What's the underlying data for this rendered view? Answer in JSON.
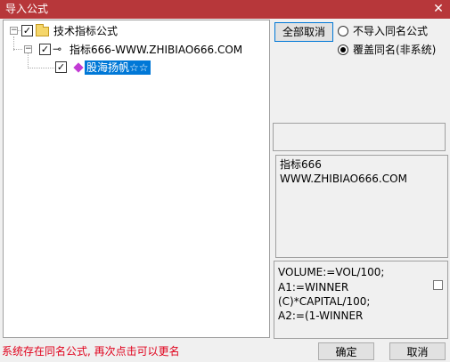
{
  "window": {
    "title": "导入公式",
    "close_glyph": "✕"
  },
  "tree": {
    "root": {
      "label": "技术指标公式",
      "checked": true,
      "expanded": true,
      "expander": "−"
    },
    "group": {
      "label": "指标666-WWW.ZHIBIAO666.COM",
      "checked": true,
      "expanded": true,
      "expander": "−"
    },
    "formula": {
      "label": "股海扬帆☆☆",
      "checked": true,
      "selected": true
    }
  },
  "actions": {
    "deselect_all_label": "全部取消",
    "ok_label": "确定",
    "cancel_label": "取消"
  },
  "options": {
    "skip_same_name_label": "不导入同名公式",
    "overwrite_label": "覆盖同名(非系统)",
    "selected": "overwrite"
  },
  "description": {
    "lines": [
      "指标666",
      "WWW.ZHIBIAO666.COM"
    ]
  },
  "code_preview": {
    "lines": [
      "VOLUME:=VOL/100;",
      "A1:=WINNER",
      "(C)*CAPITAL/100;",
      "A2:=(1-WINNER"
    ]
  },
  "status": {
    "message": "系统存在同名公式, 再次点击可以更名",
    "color": "#e0001b"
  },
  "colors": {
    "titlebar": "#b7373a",
    "selection": "#0078d7"
  },
  "icons": {
    "root": "folder-icon",
    "group": "key-icon",
    "formula": "formula-diamond-icon"
  }
}
